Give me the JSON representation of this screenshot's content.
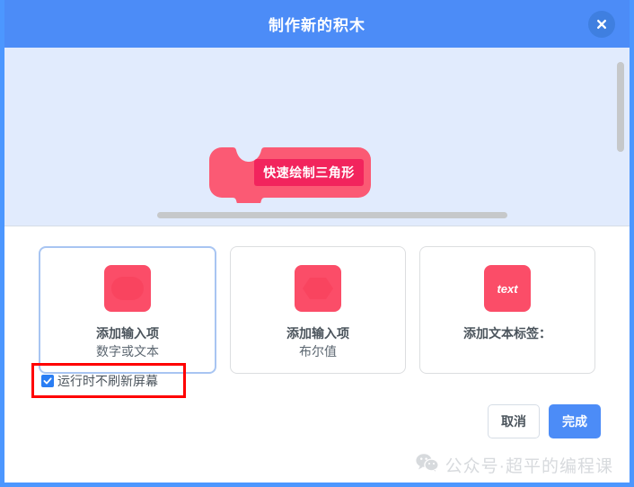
{
  "dialog": {
    "title": "制作新的积木",
    "close_icon": "close-icon",
    "accent_color": "#4c8cf7",
    "canvas_bg": "#e1ebfd"
  },
  "canvas": {
    "block": {
      "label": "快速绘制三角形",
      "block_color": "#fb5a74",
      "field_color": "#f2245d",
      "type": "define-hat-block"
    },
    "scrollbar_color": "#c6c8ca"
  },
  "options": [
    {
      "icon": "rounded-oval-icon",
      "icon_glyph": "",
      "line1": "添加输入项",
      "line2": "数字或文本",
      "selected": true,
      "icon_color": "#fb4d68"
    },
    {
      "icon": "hexagon-boolean-icon",
      "icon_glyph": "",
      "line1": "添加输入项",
      "line2": "布尔值",
      "selected": false,
      "icon_color": "#fb4d68"
    },
    {
      "icon": "text-label-icon",
      "icon_glyph": "text",
      "line1": "添加文本标签：",
      "line2": "",
      "selected": false,
      "icon_color": "#fb4d68"
    }
  ],
  "checkbox": {
    "label": "运行时不刷新屏幕",
    "checked": true,
    "highlight_color": "#ff0000"
  },
  "footer": {
    "cancel_label": "取消",
    "ok_label": "完成"
  },
  "watermark": {
    "icon": "wechat-icon",
    "text": "公众号·超平的编程课",
    "color": "#c9ccd1"
  }
}
